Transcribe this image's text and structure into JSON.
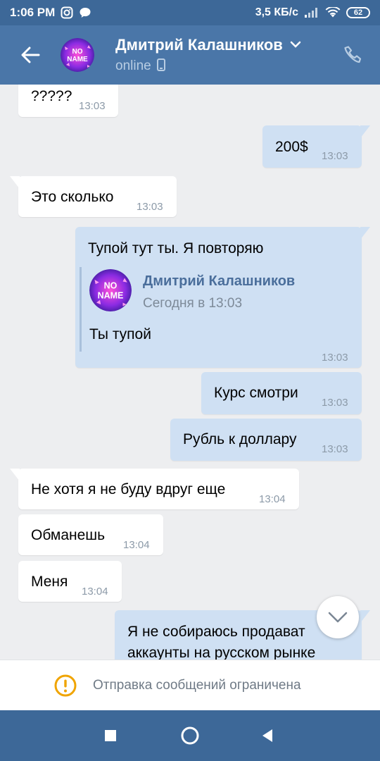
{
  "status_bar": {
    "time": "1:06 PM",
    "network_speed": "3,5 КБ/с",
    "battery": "62",
    "icons": [
      "instagram-icon",
      "chat-bubble-icon",
      "signal-icon",
      "wifi-icon",
      "battery-icon"
    ]
  },
  "header": {
    "contact_name": "Дмитрий Калашников",
    "status": "online",
    "avatar_text_top": "NO",
    "avatar_text_bottom": "NAME",
    "icons": [
      "back-arrow-icon",
      "chevron-down-icon",
      "mobile-phone-icon",
      "phone-call-icon"
    ]
  },
  "messages": [
    {
      "dir": "in",
      "text": "?????",
      "time": "13:03"
    },
    {
      "dir": "out",
      "text": "200$",
      "time": "13:03"
    },
    {
      "dir": "in",
      "text": "Это сколько",
      "time": "13:03"
    },
    {
      "dir": "out",
      "text": "Тупой тут ты. Я повторяю",
      "time": "13:03",
      "forwarded": {
        "author": "Дмитрий Калашников",
        "date": "Сегодня в 13:03",
        "text": "Ты тупой"
      }
    },
    {
      "dir": "out",
      "text": "Курс смотри",
      "time": "13:03"
    },
    {
      "dir": "out",
      "text": "Рубль к доллару",
      "time": "13:03"
    },
    {
      "dir": "in",
      "text": "Не хотя я не буду вдруг еще",
      "time": "13:04"
    },
    {
      "dir": "in",
      "text": "Обманешь",
      "time": "13:04"
    },
    {
      "dir": "in",
      "text": "Меня",
      "time": "13:04"
    },
    {
      "dir": "out",
      "line1": "Я не собираюсь продават",
      "line2": "аккаунты на русском рынке"
    }
  ],
  "notice": {
    "text": "Отправка сообщений ограничена",
    "icon": "warning-circle-icon"
  },
  "colors": {
    "header_bg": "#4a76a8",
    "status_bar_bg": "#3d6898",
    "chat_bg": "#edeef0",
    "incoming_bubble": "#ffffff",
    "outgoing_bubble": "#cfe0f3",
    "warning": "#f0a400"
  },
  "navbar": {
    "icons": [
      "recents-square-icon",
      "home-circle-icon",
      "back-triangle-icon"
    ]
  }
}
